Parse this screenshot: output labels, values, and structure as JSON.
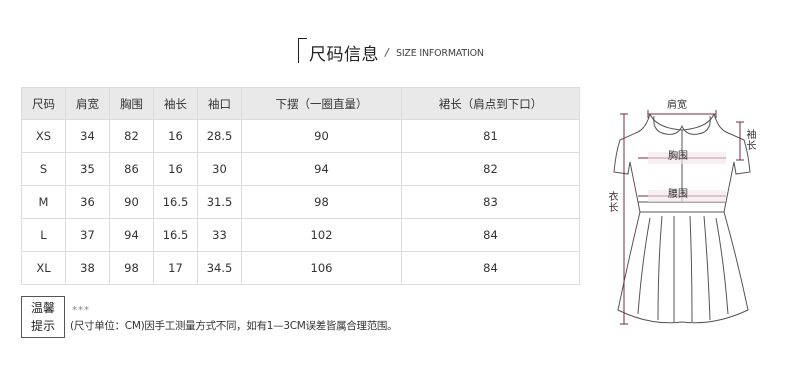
{
  "title": {
    "cn": "尺码信息",
    "separator": "/",
    "en": "SIZE INFORMATION"
  },
  "table": {
    "headers": [
      "尺码",
      "肩宽",
      "胸围",
      "袖长",
      "袖口",
      "下摆（一圈直量）",
      "裙长（肩点到下口）"
    ],
    "rows": [
      [
        "XS",
        "34",
        "82",
        "16",
        "28.5",
        "90",
        "81"
      ],
      [
        "S",
        "35",
        "86",
        "16",
        "30",
        "94",
        "82"
      ],
      [
        "M",
        "36",
        "90",
        "16.5",
        "31.5",
        "98",
        "83"
      ],
      [
        "L",
        "37",
        "94",
        "16.5",
        "33",
        "102",
        "84"
      ],
      [
        "XL",
        "38",
        "98",
        "17",
        "34.5",
        "106",
        "84"
      ]
    ]
  },
  "note": {
    "label_line1": "温馨",
    "label_line2": "提示",
    "stars": "***",
    "text": "(尺寸单位：CM)因手工测量方式不同，如有1—3CM误差皆属合理范围。"
  },
  "diagram": {
    "shoulder": "肩宽",
    "sleeve": "袖长",
    "chest": "胸围",
    "waist": "腰围",
    "length": "衣长"
  }
}
